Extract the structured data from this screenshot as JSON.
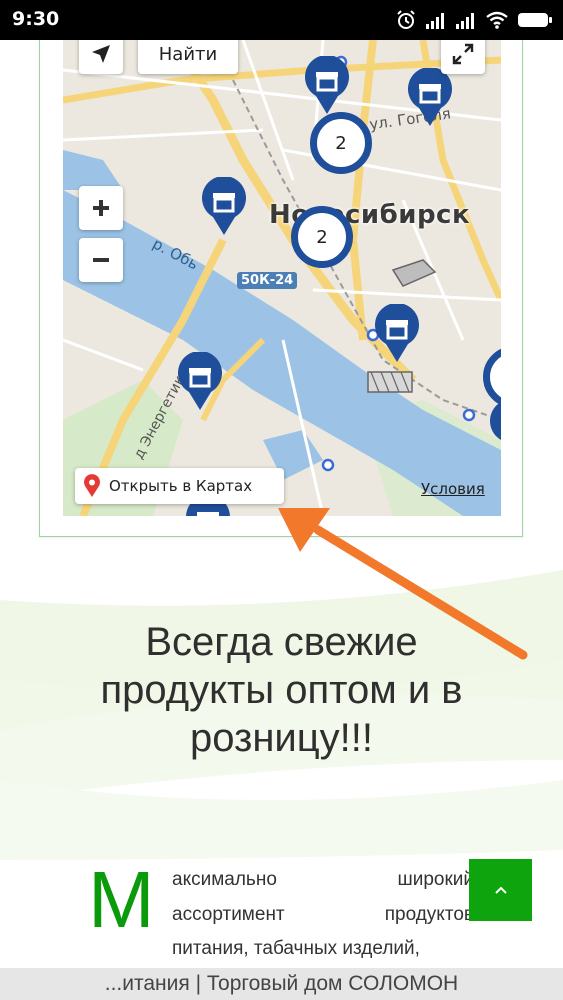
{
  "status_bar": {
    "time": "9:30",
    "icons": [
      "alarm-icon",
      "signal-icon",
      "signal-icon",
      "wifi-icon",
      "battery-icon"
    ]
  },
  "map": {
    "find_label": "Найти",
    "city_label": "Новосибирск",
    "street_label": "ул. Гоголя",
    "river_label": "р. Обь",
    "road_badge": "50К-24",
    "road_label": "д Энергетиков",
    "open_in_maps_label": "Открыть в Картах",
    "terms_label": "Условия",
    "clusters": [
      "2",
      "2"
    ],
    "colors": {
      "pin": "#1f4f9a",
      "water": "#9cc3e6",
      "road": "#f6d57a"
    }
  },
  "content": {
    "headline_lines": [
      "Всегда свежие",
      "продукты оптом и в",
      "розницу!!!"
    ],
    "dropcap": "М",
    "paragraph_lines": [
      [
        "аксимально",
        "широкий"
      ],
      [
        "ассортимент",
        "продуктов"
      ],
      [
        "питания, табачных изделий,",
        ""
      ]
    ],
    "accent_color": "#0b9a0b",
    "scroll_top_color": "#0ea40e"
  },
  "browser": {
    "page_title": "...итания | Торговый дом СОЛОМОН"
  }
}
